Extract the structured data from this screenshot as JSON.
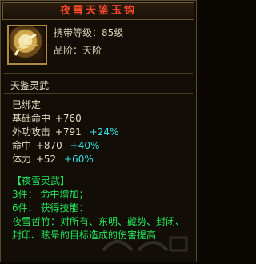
{
  "item": {
    "name": "夜雪天鉴玉钩",
    "level_label": "携带等级：85级",
    "quality_label": "品阶：天阶",
    "type": "天鉴灵武",
    "bound": "已绑定"
  },
  "stats": [
    {
      "label": "基础命中",
      "value": "+760",
      "percent": ""
    },
    {
      "label": "外功攻击",
      "value": "+791",
      "percent": "+24%"
    },
    {
      "label": "命中",
      "value": "+870",
      "percent": "+40%"
    },
    {
      "label": "体力",
      "value": "+52",
      "percent": "+60%"
    }
  ],
  "set": {
    "title": "【夜雪灵武】",
    "lines": [
      {
        "label": "3件：",
        "text": "命中增加；"
      },
      {
        "label": "6件：",
        "text": "获得技能："
      }
    ],
    "skill_text": "夜雪哲竹：对所有、东明、藏势、封闭、封印、眩晕的目标造成的伤害提高"
  },
  "icons": {
    "item": "weapon-hook-icon"
  },
  "colors": {
    "title": "#ff4a2a",
    "percent": "#35e0e0",
    "set": "#24e65a"
  }
}
